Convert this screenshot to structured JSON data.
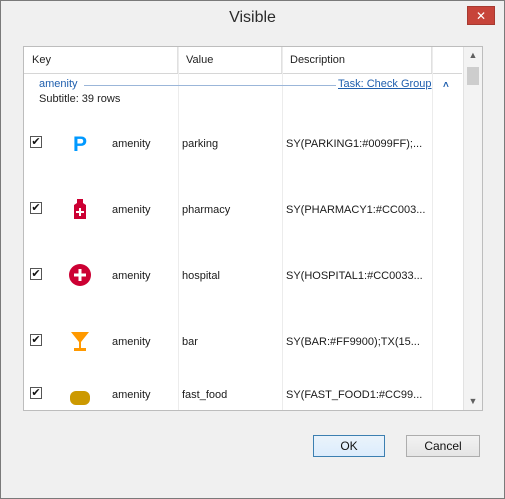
{
  "window": {
    "title": "Visible",
    "close_glyph": "✕"
  },
  "table": {
    "columns": [
      "Key",
      "Value",
      "Description"
    ],
    "group": {
      "name": "amenity",
      "task_link": "Task: Check Group",
      "subtitle": "Subtitle: 39 rows",
      "toggle_glyph": "˄"
    },
    "rows": [
      {
        "checked": "✔",
        "icon": "parking-icon",
        "key": "amenity",
        "value": "parking",
        "description": "SY(PARKING1:#0099FF);..."
      },
      {
        "checked": "✔",
        "icon": "pharmacy-icon",
        "key": "amenity",
        "value": "pharmacy",
        "description": "SY(PHARMACY1:#CC003..."
      },
      {
        "checked": "✔",
        "icon": "hospital-icon",
        "key": "amenity",
        "value": "hospital",
        "description": "SY(HOSPITAL1:#CC0033..."
      },
      {
        "checked": "✔",
        "icon": "bar-icon",
        "key": "amenity",
        "value": "bar",
        "description": "SY(BAR:#FF9900);TX(15..."
      },
      {
        "checked": "✔",
        "icon": "fast-food-icon",
        "key": "amenity",
        "value": "fast_food",
        "description": "SY(FAST_FOOD1:#CC99..."
      }
    ]
  },
  "scrollbar": {
    "up_glyph": "▲",
    "down_glyph": "▼"
  },
  "buttons": {
    "ok": "OK",
    "cancel": "Cancel"
  },
  "colors": {
    "parking": "#0099FF",
    "pharmacy": "#CC0033",
    "hospital": "#CC0033",
    "bar": "#FF9900",
    "fast_food": "#CC9900"
  }
}
